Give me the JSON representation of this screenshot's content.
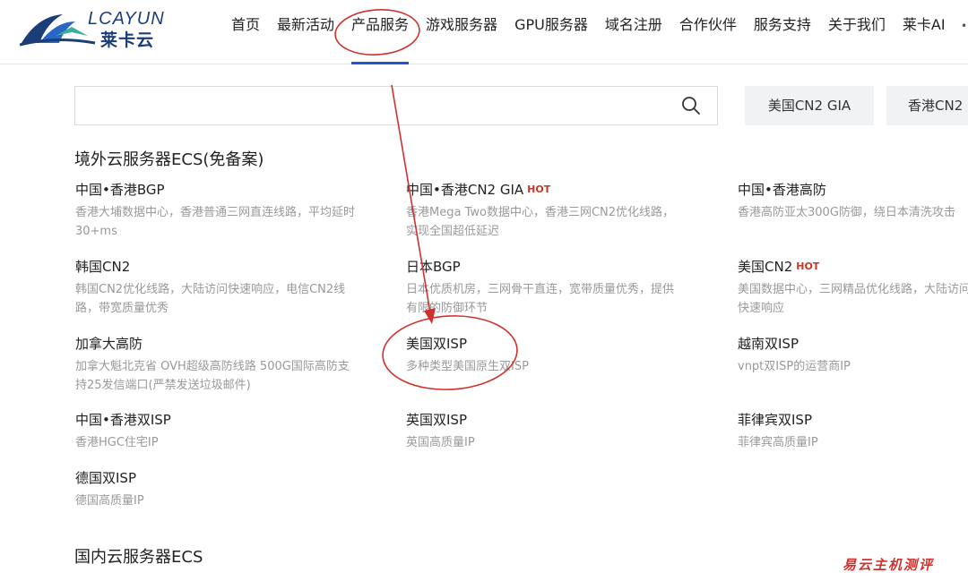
{
  "header": {
    "logo_en": "LCAYUN",
    "logo_cn": "莱卡云",
    "nav": [
      {
        "label": "首页"
      },
      {
        "label": "最新活动"
      },
      {
        "label": "产品服务"
      },
      {
        "label": "游戏服务器"
      },
      {
        "label": "GPU服务器"
      },
      {
        "label": "域名注册"
      },
      {
        "label": "合作伙伴"
      },
      {
        "label": "服务支持"
      },
      {
        "label": "关于我们"
      },
      {
        "label": "莱卡AI"
      }
    ],
    "active_index": 2
  },
  "search": {
    "value": "",
    "placeholder": "",
    "quick_tags": [
      {
        "label": "美国CN2 GIA"
      },
      {
        "label": "香港CN2"
      }
    ]
  },
  "sections": [
    {
      "title": "境外云服务器ECS(免备案)",
      "products": [
        {
          "name": "中国•香港BGP",
          "hot": "",
          "desc": "香港大埔数据中心，香港普通三网直连线路，平均延时30+ms"
        },
        {
          "name": "中国•香港CN2 GIA",
          "hot": "HOT",
          "desc": "香港Mega Two数据中心，香港三网CN2优化线路，实现全国超低延迟"
        },
        {
          "name": "中国•香港高防",
          "hot": "",
          "desc": "香港高防亚太300G防御，绕日本清洗攻击"
        },
        {
          "name": "韩国CN2",
          "hot": "",
          "desc": "韩国CN2优化线路，大陆访问快速响应，电信CN2线路，带宽质量优秀"
        },
        {
          "name": "日本BGP",
          "hot": "",
          "desc": "日本优质机房，三网骨干直连，宽带质量优秀，提供有限的防御环节"
        },
        {
          "name": "美国CN2",
          "hot": "HOT",
          "desc": "美国数据中心，三网精品优化线路，大陆访问快速响应"
        },
        {
          "name": "加拿大高防",
          "hot": "",
          "desc": "加拿大魁北克省 OVH超级高防线路 500G国际高防支持25发信端口(严禁发送垃圾邮件)"
        },
        {
          "name": "美国双ISP",
          "hot": "",
          "desc": "多种类型美国原生双ISP"
        },
        {
          "name": "越南双ISP",
          "hot": "",
          "desc": "vnpt双ISP的运营商IP"
        },
        {
          "name": "中国•香港双ISP",
          "hot": "",
          "desc": "香港HGC住宅IP"
        },
        {
          "name": "英国双ISP",
          "hot": "",
          "desc": "英国高质量IP"
        },
        {
          "name": "菲律宾双ISP",
          "hot": "",
          "desc": "菲律宾高质量IP"
        },
        {
          "name": "德国双ISP",
          "hot": "",
          "desc": "德国高质量IP"
        }
      ]
    },
    {
      "title": "国内云服务器ECS",
      "products": []
    }
  ],
  "watermark": "易云主机测评",
  "colors": {
    "accent": "#1f58c6",
    "hot": "#c0392b",
    "annotation": "#d0312d"
  }
}
